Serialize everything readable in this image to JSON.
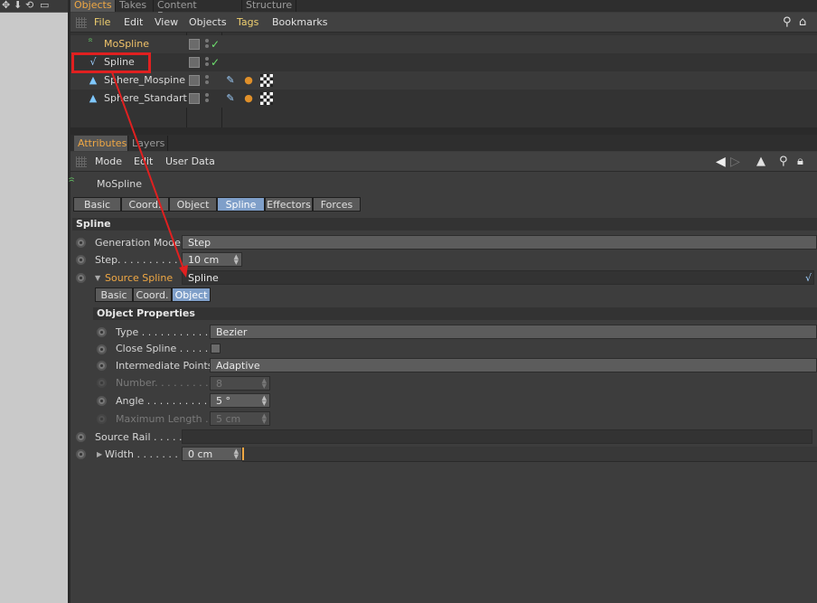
{
  "top_tabs": [
    "Objects",
    "Takes",
    "Content Browser",
    "Structure"
  ],
  "obj_menu": [
    "File",
    "Edit",
    "View",
    "Objects",
    "Tags",
    "Bookmarks"
  ],
  "objects": [
    {
      "name": "MoSpline",
      "color": "#f0c36a",
      "icon": "mospline-icon"
    },
    {
      "name": "Spline",
      "color": "#d8d8d8",
      "icon": "spline-icon"
    },
    {
      "name": "Sphere_Mospine",
      "color": "#d8d8d8",
      "icon": "sphere-icon"
    },
    {
      "name": "Sphere_Standart",
      "color": "#d8d8d8",
      "icon": "sphere-icon"
    }
  ],
  "attr_tabs": [
    "Attributes",
    "Layers"
  ],
  "attr_menu": [
    "Mode",
    "Edit",
    "User Data"
  ],
  "attr_object": "MoSpline",
  "main_tabs": [
    "Basic",
    "Coord.",
    "Object",
    "Spline",
    "Effectors",
    "Forces"
  ],
  "main_tab_selected": "Spline",
  "section_spline": "Spline",
  "generation_mode": {
    "label": "Generation Mode",
    "value": "Step"
  },
  "step": {
    "label": "Step. . . . . . . . . . .",
    "value": "10 cm"
  },
  "source_spline": {
    "label": "Source Spline",
    "value": "Spline"
  },
  "sub_tabs": [
    "Basic",
    "Coord.",
    "Object"
  ],
  "sub_tab_selected": "Object",
  "section_object_props": "Object Properties",
  "type": {
    "label": "Type . . . . . . . . . . . .",
    "value": "Bezier"
  },
  "close_spline": {
    "label": "Close Spline . . . . . ."
  },
  "intermediate_points": {
    "label": "Intermediate Points",
    "value": "Adaptive"
  },
  "number": {
    "label": "Number. . . . . . . . . .",
    "value": "8"
  },
  "angle": {
    "label": "Angle . . . . . . . . . . .",
    "value": "5 °"
  },
  "max_length": {
    "label": "Maximum Length . .",
    "value": "5 cm"
  },
  "source_rail": {
    "label": "Source Rail . . . . . ."
  },
  "width": {
    "label": "Width . . . . . . . .",
    "value": "0 cm"
  },
  "colors": {
    "accent": "#f0a844",
    "selected_tab": "#7f9fc9",
    "highlight_box": "#e02020",
    "arrow": "#e02020"
  }
}
